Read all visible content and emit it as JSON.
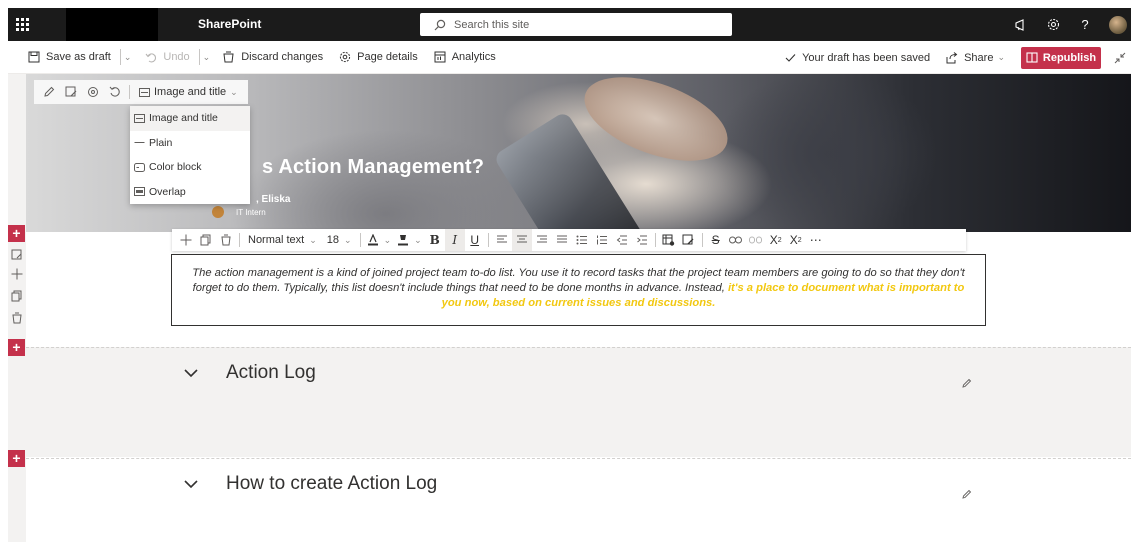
{
  "suitebar": {
    "app_name": "SharePoint",
    "search_placeholder": "Search this site"
  },
  "commandbar": {
    "save_as_draft": "Save as draft",
    "undo": "Undo",
    "discard_changes": "Discard changes",
    "page_details": "Page details",
    "analytics": "Analytics",
    "draft_status": "Your draft has been saved",
    "share": "Share",
    "republish": "Republish"
  },
  "hero": {
    "layout_selected": "Image and title",
    "title_partial": "s Action Management?",
    "author_partial": ", Eliska",
    "author_role": "IT Intern"
  },
  "layout_menu": {
    "items": [
      "Image and title",
      "Plain",
      "Color block",
      "Overlap"
    ],
    "selected_index": 0
  },
  "format_toolbar": {
    "style": "Normal text",
    "font_size": "18"
  },
  "textbox": {
    "text_normal": "The action management is a kind of joined project team to-do list. You use it to record tasks that the project team members are going to do so that they don't forget to do them. Typically, this list doesn't include things that need to be done months in advance. Instead, ",
    "text_highlight": "it's a place to document what is important to you now, based on current issues and discussions."
  },
  "sections": [
    {
      "title": "Action Log"
    },
    {
      "title": "How to create Action Log"
    }
  ],
  "colors": {
    "accent": "#c4314b",
    "highlight": "#f2c811",
    "suitebar": "#1b1b1b"
  }
}
